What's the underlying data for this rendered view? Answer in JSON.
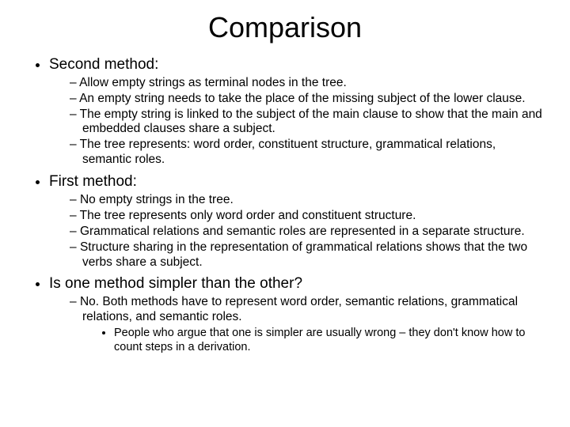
{
  "title": "Comparison",
  "sections": [
    {
      "heading": "Second method:",
      "items": [
        "Allow empty strings as terminal nodes in the tree.",
        "An empty string needs to take the place of the missing subject of the lower clause.",
        "The empty string is linked to the subject of the main clause to show that the main and embedded clauses share a subject.",
        "The tree represents: word order, constituent structure, grammatical relations, semantic roles."
      ]
    },
    {
      "heading": "First method:",
      "items": [
        "No empty strings in the tree.",
        "The tree represents only word order and constituent structure.",
        "Grammatical relations and semantic roles are represented in a separate structure.",
        "Structure sharing in the representation of grammatical relations shows that the two verbs share a subject."
      ]
    },
    {
      "heading": "Is one method simpler than the other?",
      "items": [
        "No.  Both methods have to represent word order, semantic relations, grammatical relations, and semantic roles."
      ],
      "subitems": [
        "People who argue that one is simpler are usually wrong – they don't know how to count steps in a derivation."
      ]
    }
  ]
}
